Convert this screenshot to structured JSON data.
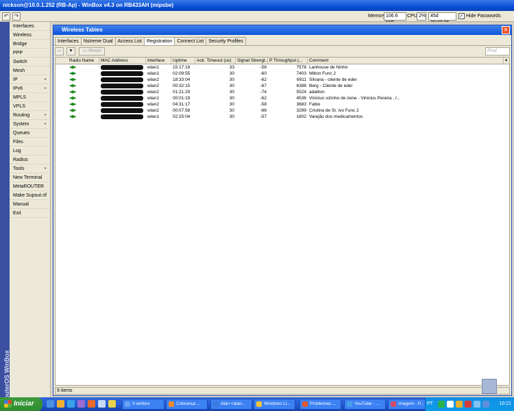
{
  "app": {
    "title": "nickson@10.0.1.252 (RB-Ap) - WinBox v4.3 on RB433AH (mipsbe)",
    "brand_vertical": "RouterOS WinBox"
  },
  "toolbar": {
    "back_label": "↶",
    "forward_label": "↷",
    "memory_label": "Memory:",
    "memory_value": "106.6 MiB",
    "cpu_label": "CPU:",
    "cpu_value": "2%",
    "uptime_value": "45d 20:23:36",
    "hide_passwords_label": "Hide Passwords",
    "hide_passwords_checked": "✓"
  },
  "sidebar": {
    "items": [
      {
        "label": "Interfaces",
        "submenu": false
      },
      {
        "label": "Wireless",
        "submenu": false
      },
      {
        "label": "Bridge",
        "submenu": false
      },
      {
        "label": "PPP",
        "submenu": false
      },
      {
        "label": "Switch",
        "submenu": false
      },
      {
        "label": "Mesh",
        "submenu": false
      },
      {
        "label": "IP",
        "submenu": true
      },
      {
        "label": "IPv6",
        "submenu": true
      },
      {
        "label": "MPLS",
        "submenu": false
      },
      {
        "label": "VPLS",
        "submenu": false
      },
      {
        "label": "Routing",
        "submenu": true
      },
      {
        "label": "System",
        "submenu": true
      },
      {
        "label": "Queues",
        "submenu": false
      },
      {
        "label": "Files",
        "submenu": false
      },
      {
        "label": "Log",
        "submenu": false
      },
      {
        "label": "Radius",
        "submenu": false
      },
      {
        "label": "Tools",
        "submenu": true
      },
      {
        "label": "New Terminal",
        "submenu": false
      },
      {
        "label": "MetaROUTER",
        "submenu": false
      },
      {
        "label": "Make Supout.rif",
        "submenu": false
      },
      {
        "label": "Manual",
        "submenu": false
      },
      {
        "label": "Exit",
        "submenu": false
      }
    ],
    "submenu_arrow": "▸"
  },
  "window": {
    "title": "Wireless Tables",
    "close_label": "✕",
    "tabs": [
      "Interfaces",
      "Nstreme Dual",
      "Access List",
      "Registration",
      "Connect List",
      "Security Profiles"
    ],
    "active_tab": "Registration",
    "reset_label": "Reset",
    "filter_icon": "filter-icon",
    "find_placeholder": "Find",
    "status_text": "9 items"
  },
  "table": {
    "columns": [
      "Radio Name",
      "MAC Address",
      "Interface",
      "Uptime",
      "Ack. Timeout (us)",
      "Signal Strengt...",
      "P Throughput (...",
      "Comment"
    ],
    "rows": [
      {
        "interface": "wlan1",
        "uptime": "15:17:19",
        "ack": "33",
        "signal": "-58",
        "throughput": "7578",
        "comment": "Lanhouse de Ninho"
      },
      {
        "interface": "wlan1",
        "uptime": "02:09:55",
        "ack": "30",
        "signal": "-60",
        "throughput": "7403",
        "comment": "Milton Func 2"
      },
      {
        "interface": "wlan2",
        "uptime": "18:33:04",
        "ack": "30",
        "signal": "-62",
        "throughput": "6911",
        "comment": "Silvana - cliente de eder"
      },
      {
        "interface": "wlan2",
        "uptime": "00:32:15",
        "ack": "30",
        "signal": "-67",
        "throughput": "6388",
        "comment": "Berg - Cliente de eder"
      },
      {
        "interface": "wlan2",
        "uptime": "01:21:29",
        "ack": "30",
        "signal": "-74",
        "throughput": "5524",
        "comment": "adailton"
      },
      {
        "interface": "wlan1",
        "uptime": "00:01:19",
        "ack": "30",
        "signal": "-62",
        "throughput": "4536",
        "comment": "Vinicius vizinho de irene - Vinicius Pereira , r..."
      },
      {
        "interface": "wlan2",
        "uptime": "04:31:17",
        "ack": "30",
        "signal": "-58",
        "throughput": "3683",
        "comment": "Fabio"
      },
      {
        "interface": "wlan2",
        "uptime": "00:07:58",
        "ack": "30",
        "signal": "-66",
        "throughput": "3299",
        "comment": "Cristina de Sr. ivo Func 2"
      },
      {
        "interface": "wlan1",
        "uptime": "02:25:04",
        "ack": "30",
        "signal": "-57",
        "throughput": "1802",
        "comment": "Varejão dos medicamentos"
      }
    ]
  },
  "taskbar": {
    "start_label": "Iniciar",
    "tasks": [
      "3 winbox",
      "Cobrança ...",
      "Alan <alan...",
      "Windows Li...",
      "Problemas ...",
      "YouTube - ...",
      "imagem - P..."
    ],
    "language": "PT",
    "clock": "10:21"
  }
}
